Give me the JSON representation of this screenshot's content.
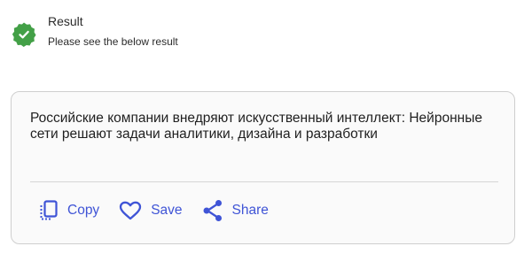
{
  "header": {
    "status_icon": "check-circle-icon",
    "status_color": "#43a047",
    "title": "Result",
    "subtitle": "Please see the below result"
  },
  "result": {
    "text": "Российские компании внедряют искусственный интеллект: Нейронные сети решают задачи аналитики, дизайна и разработки"
  },
  "actions": {
    "accent_color": "#3f54d6",
    "copy": {
      "label": "Copy",
      "icon": "copy-icon"
    },
    "save": {
      "label": "Save",
      "icon": "heart-icon"
    },
    "share": {
      "label": "Share",
      "icon": "share-icon"
    }
  }
}
